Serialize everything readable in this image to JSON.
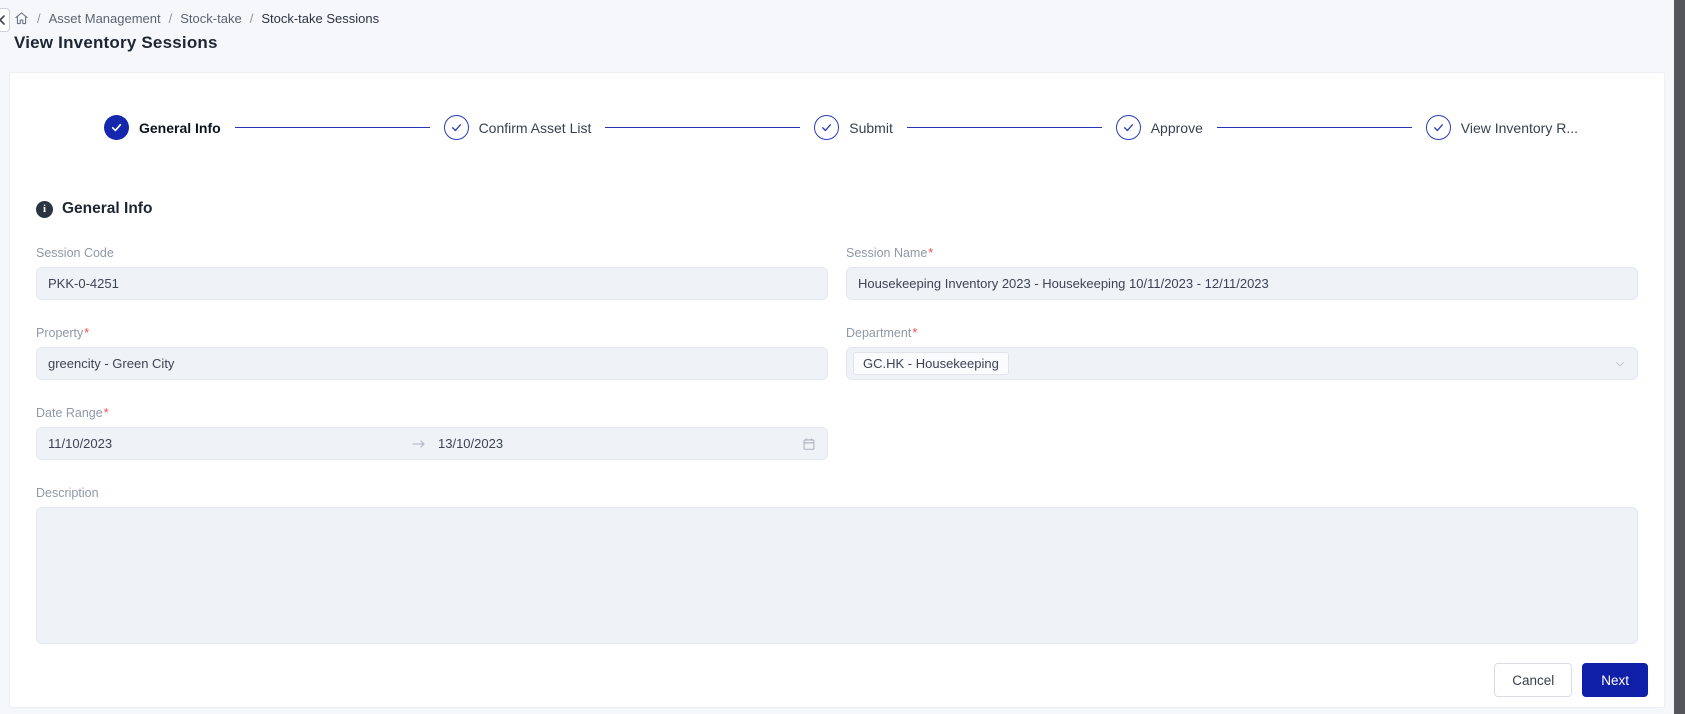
{
  "page": {
    "title": "View Inventory Sessions"
  },
  "breadcrumb": {
    "separator": "/",
    "items": [
      {
        "label": "Asset Management"
      },
      {
        "label": "Stock-take"
      },
      {
        "label": "Stock-take Sessions"
      }
    ]
  },
  "stepper": {
    "steps": [
      {
        "label": "General Info",
        "state": "active"
      },
      {
        "label": "Confirm Asset List",
        "state": "done"
      },
      {
        "label": "Submit",
        "state": "done"
      },
      {
        "label": "Approve",
        "state": "done"
      },
      {
        "label": "View Inventory R...",
        "state": "done"
      }
    ]
  },
  "section": {
    "title": "General Info"
  },
  "form": {
    "session_code": {
      "label": "Session Code",
      "value": "PKK-0-4251"
    },
    "session_name": {
      "label": "Session Name",
      "required": "*",
      "value": "Housekeeping Inventory 2023 - Housekeeping 10/11/2023 - 12/11/2023"
    },
    "property": {
      "label": "Property",
      "required": "*",
      "value": "greencity - Green City"
    },
    "department": {
      "label": "Department",
      "required": "*",
      "value": "GC.HK - Housekeeping"
    },
    "date_range": {
      "label": "Date Range",
      "required": "*",
      "start": "11/10/2023",
      "end": "13/10/2023"
    },
    "description": {
      "label": "Description",
      "value": ""
    }
  },
  "footer": {
    "cancel_label": "Cancel",
    "next_label": "Next"
  },
  "colors": {
    "primary_button": "#101fa7",
    "stepper_blue": "#2334b4",
    "step_fill": "#1427ad",
    "required_asterisk": "#f5494d",
    "input_bg": "#eff3f8",
    "scrollbar_strip": "#55565b"
  }
}
